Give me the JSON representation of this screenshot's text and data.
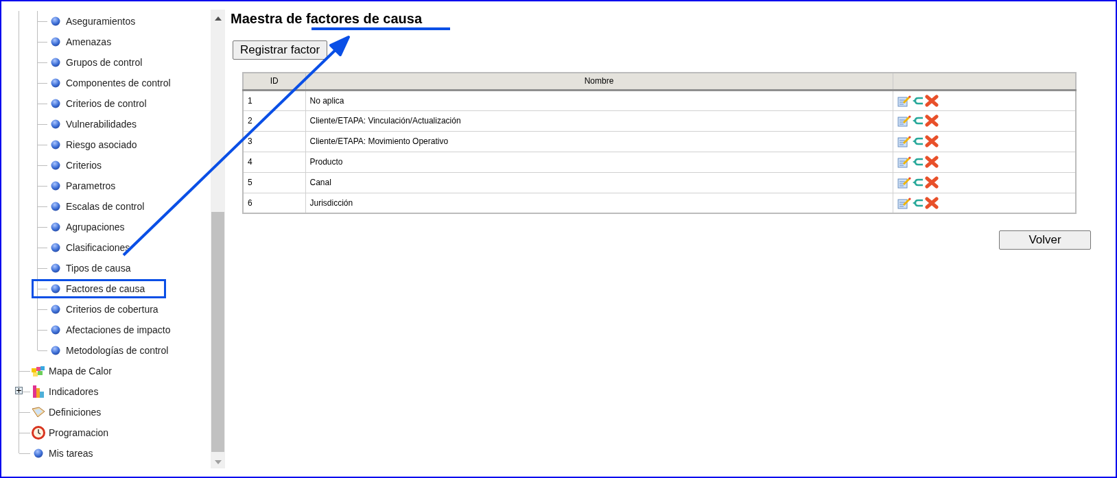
{
  "sidebar": {
    "tree": [
      {
        "children": [
          {
            "label": "Aseguramientos",
            "highlighted": false
          },
          {
            "label": "Amenazas",
            "highlighted": false
          },
          {
            "label": "Grupos de control",
            "highlighted": false
          },
          {
            "label": "Componentes de control",
            "highlighted": false
          },
          {
            "label": "Criterios de control",
            "highlighted": false
          },
          {
            "label": "Vulnerabilidades",
            "highlighted": false
          },
          {
            "label": "Riesgo asociado",
            "highlighted": false
          },
          {
            "label": "Criterios",
            "highlighted": false
          },
          {
            "label": "Parametros",
            "highlighted": false
          },
          {
            "label": "Escalas de control",
            "highlighted": false
          },
          {
            "label": "Agrupaciones",
            "highlighted": false
          },
          {
            "label": "Clasificaciones",
            "highlighted": false
          },
          {
            "label": "Tipos de causa",
            "highlighted": false
          },
          {
            "label": "Factores de causa",
            "highlighted": true
          },
          {
            "label": "Criterios de cobertura",
            "highlighted": false
          },
          {
            "label": "Afectaciones de impacto",
            "highlighted": false
          },
          {
            "label": "Metodologías de control",
            "highlighted": false
          }
        ]
      },
      {
        "label": "Mapa de Calor",
        "kind": "heatmap"
      },
      {
        "label": "Indicadores",
        "kind": "chart",
        "expanded": false
      },
      {
        "label": "Definiciones",
        "kind": "book"
      },
      {
        "label": "Programacion",
        "kind": "clock"
      },
      {
        "label": "Mis tareas",
        "kind": "ball"
      }
    ]
  },
  "main": {
    "title_start": "Maestra de",
    "title_underlined": "factores de causa",
    "register_button": "Registrar factor",
    "table": {
      "columns": [
        "ID",
        "Nombre"
      ],
      "rows": [
        {
          "id": "1",
          "name": "No aplica"
        },
        {
          "id": "2",
          "name": "Cliente/ETAPA: Vinculación/Actualización"
        },
        {
          "id": "3",
          "name": "Cliente/ETAPA: Movimiento Operativo"
        },
        {
          "id": "4",
          "name": "Producto"
        },
        {
          "id": "5",
          "name": "Canal"
        },
        {
          "id": "6",
          "name": "Jurisdicción"
        }
      ]
    },
    "back_button": "Volver"
  }
}
